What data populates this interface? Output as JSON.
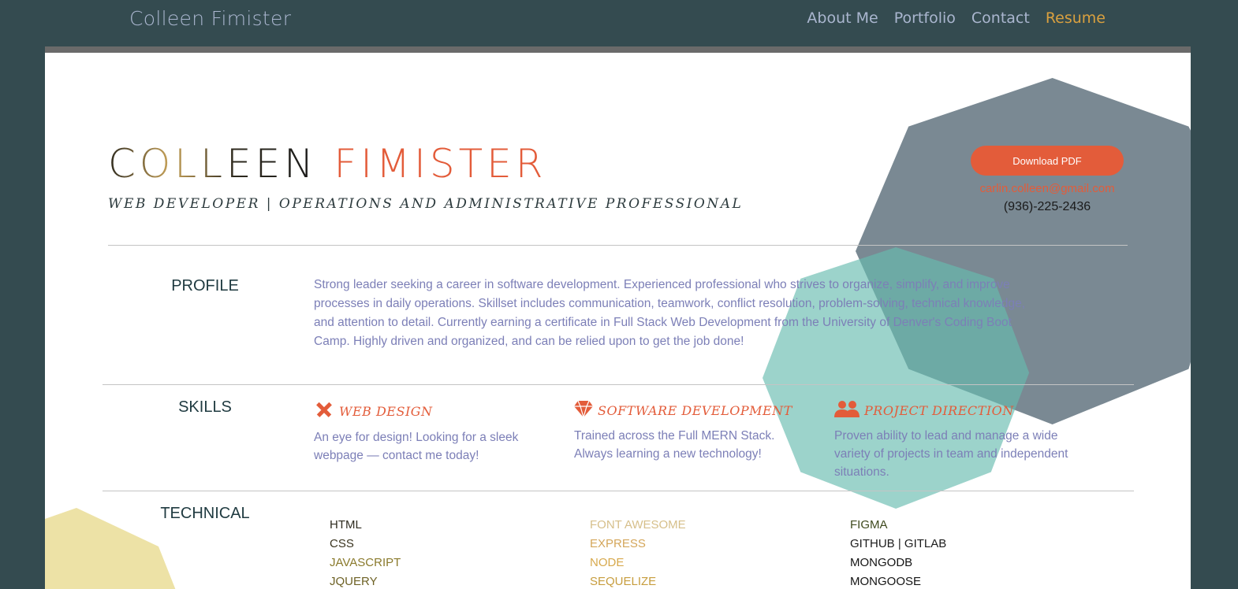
{
  "nav": {
    "brand": "Colleen Fimister",
    "links": [
      "About Me",
      "Portfolio",
      "Contact",
      "Resume"
    ],
    "active": "Resume"
  },
  "header": {
    "first_name": "COLLEEN",
    "last_name": "FIMISTER",
    "tagline": "WEB DEVELOPER | OPERATIONS AND ADMINISTRATIVE PROFESSIONAL",
    "download_label": "Download PDF",
    "email": "carlin.colleen@gmail.com",
    "phone": "(936)-225-2436"
  },
  "profile": {
    "heading": "PROFILE",
    "text": "Strong leader seeking a career in software development. Experienced professional who strives to organize, simplify, and improve processes in daily operations. Skillset includes communication, teamwork, conflict resolution, problem-solving, technical knowledge, and attention to detail. Currently earning a certificate in Full Stack Web Development from the University of Denver's Coding Boot Camp. Highly driven and organized, and can be relied upon to get the job done!"
  },
  "skills": {
    "heading": "SKILLS",
    "items": [
      {
        "title": "WEB DESIGN",
        "icon": "pencil-ruler-icon",
        "desc": "An eye for design! Looking for a sleek webpage — contact me today!"
      },
      {
        "title": "SOFTWARE DEVELOPMENT",
        "icon": "gem-icon",
        "desc": "Trained across the Full MERN Stack. Always learning a new technology!"
      },
      {
        "title": "PROJECT DIRECTION",
        "icon": "users-icon",
        "desc": "Proven ability to lead and manage a wide variety of projects in team and independent situations."
      }
    ]
  },
  "technical": {
    "heading": "TECHNICAL",
    "col1": [
      "HTML",
      "CSS",
      "JAVASCRIPT",
      "JQUERY"
    ],
    "col2": [
      "FONT AWESOME",
      "EXPRESS",
      "NODE",
      "SEQUELIZE"
    ],
    "col3": [
      "FIGMA",
      "GITHUB | GITLAB",
      "MONGODB",
      "MONGOOSE"
    ]
  },
  "colors": {
    "background": "#344b50",
    "accent": "#e35c3a",
    "nav_active": "#d9a03f",
    "body_text": "#7c7fb7"
  }
}
